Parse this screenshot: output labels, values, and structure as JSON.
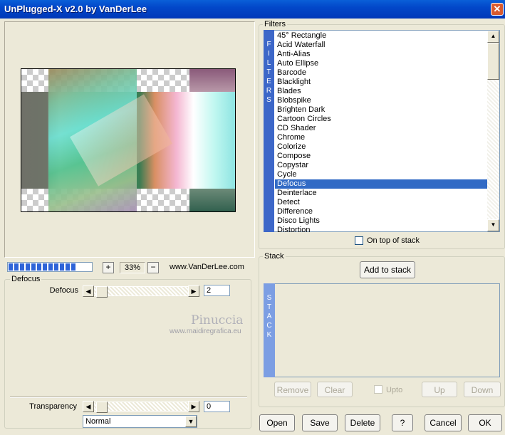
{
  "window": {
    "title": "UnPlugged-X v2.0 by VanDerLee",
    "close_label": "✕"
  },
  "preview": {
    "zoom": "33%",
    "zoom_in_label": "+",
    "zoom_out_label": "−",
    "website": "www.VanDerLee.com",
    "progress_blocks": 12
  },
  "params": {
    "group_title": "Defocus",
    "defocus_label": "Defocus",
    "defocus_value": "2",
    "transparency_label": "Transparency",
    "transparency_value": "0",
    "blend_mode": "Normal"
  },
  "watermark": {
    "line1": "Pinuccia",
    "line2": "www.maidiregrafica.eu"
  },
  "filters": {
    "title": "Filters",
    "band_text": "FILTERS",
    "items": [
      "45° Rectangle",
      "Acid Waterfall",
      "Anti-Alias",
      "Auto Ellipse",
      "Barcode",
      "Blacklight",
      "Blades",
      "Blobspike",
      "Brighten Dark",
      "Cartoon Circles",
      "CD Shader",
      "Chrome",
      "Colorize",
      "Compose",
      "Copystar",
      "Cycle",
      "Defocus",
      "Deinterlace",
      "Detect",
      "Difference",
      "Disco Lights",
      "Distortion"
    ],
    "selected": "Defocus",
    "on_top_label": "On top of stack"
  },
  "stack": {
    "title": "Stack",
    "band_text": "STACK",
    "add_label": "Add to stack",
    "remove_label": "Remove",
    "clear_label": "Clear",
    "upto_label": "Upto",
    "up_label": "Up",
    "down_label": "Down"
  },
  "footer": {
    "open": "Open",
    "save": "Save",
    "delete": "Delete",
    "help": "?",
    "cancel": "Cancel",
    "ok": "OK"
  },
  "colors": {
    "titlebar": "#0A5FD8",
    "selection": "#316AC5",
    "filter_band": "#3D67C8",
    "stack_band": "#7C9EE3"
  }
}
